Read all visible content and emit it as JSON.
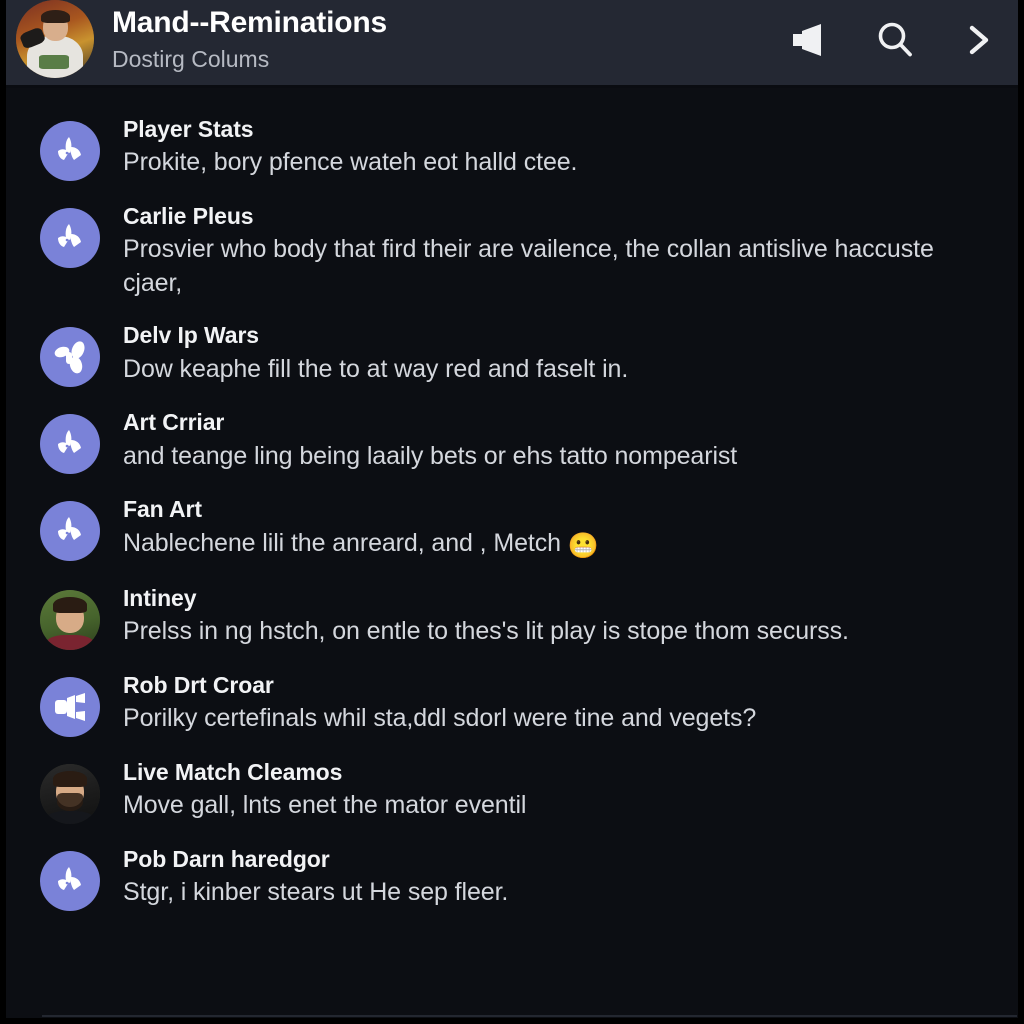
{
  "header": {
    "title": "Mand--Reminations",
    "subtitle": "Dostirg Colums",
    "avatar_name": "channel-avatar-photo",
    "actions": [
      {
        "name": "speaker-icon",
        "label": "Speaker"
      },
      {
        "name": "search-icon",
        "label": "Search"
      },
      {
        "name": "chevron-right-icon",
        "label": "Forward"
      }
    ]
  },
  "theme": {
    "header_bg": "#242833",
    "page_bg": "#0c0e13",
    "avatar_purple": "#7a82d8",
    "title_color": "#f2f3f5",
    "desc_color": "#d4d7dd",
    "subtitle_color": "#b6bac3",
    "divider_color": "#232730"
  },
  "list": {
    "items": [
      {
        "title": "Player Stats",
        "desc": "Prokite, bory pfence wateh eot halld ctee.",
        "avatar_type": "icon",
        "icon": "bird-icon",
        "emoji": ""
      },
      {
        "title": "Carlie Pleus",
        "desc": "Prosvier who body that fird their are vailence, the collan antislive haccuste cjaer,",
        "avatar_type": "icon",
        "icon": "bird-icon",
        "emoji": ""
      },
      {
        "title": "Delv Ip Wars",
        "desc": "Dow keaphe fill the to at way red and faselt in.",
        "avatar_type": "icon",
        "icon": "share-icon",
        "emoji": ""
      },
      {
        "title": "Art Crriar",
        "desc": "and teange ling being laaily bets or ehs tatto nompearist",
        "avatar_type": "icon",
        "icon": "bird-icon",
        "emoji": ""
      },
      {
        "title": "Fan Art",
        "desc": "Nablechene lili the anreard, and , Metch",
        "avatar_type": "icon",
        "icon": "bird-icon",
        "emoji": "😬"
      },
      {
        "title": "Intiney",
        "desc": "Prelss in ng hstch, on entle to thes's lit play is stope thom securss.",
        "avatar_type": "photo",
        "icon": "person-photo-green",
        "emoji": ""
      },
      {
        "title": "Rob Drt Croar",
        "desc": "Porilky certefinals whil sta,ddl sdorl were tine and vegets?",
        "avatar_type": "icon",
        "icon": "megaphone-icon",
        "emoji": ""
      },
      {
        "title": "Live Match Cleamos",
        "desc": "Move gall, lnts enet the mator eventil",
        "avatar_type": "photo",
        "icon": "person-photo-dark",
        "emoji": ""
      },
      {
        "title": "Pob Darn haredgor",
        "desc": "Stgr, i kinber stears ut He sep fleer.",
        "avatar_type": "icon",
        "icon": "bird-icon",
        "emoji": ""
      }
    ]
  }
}
